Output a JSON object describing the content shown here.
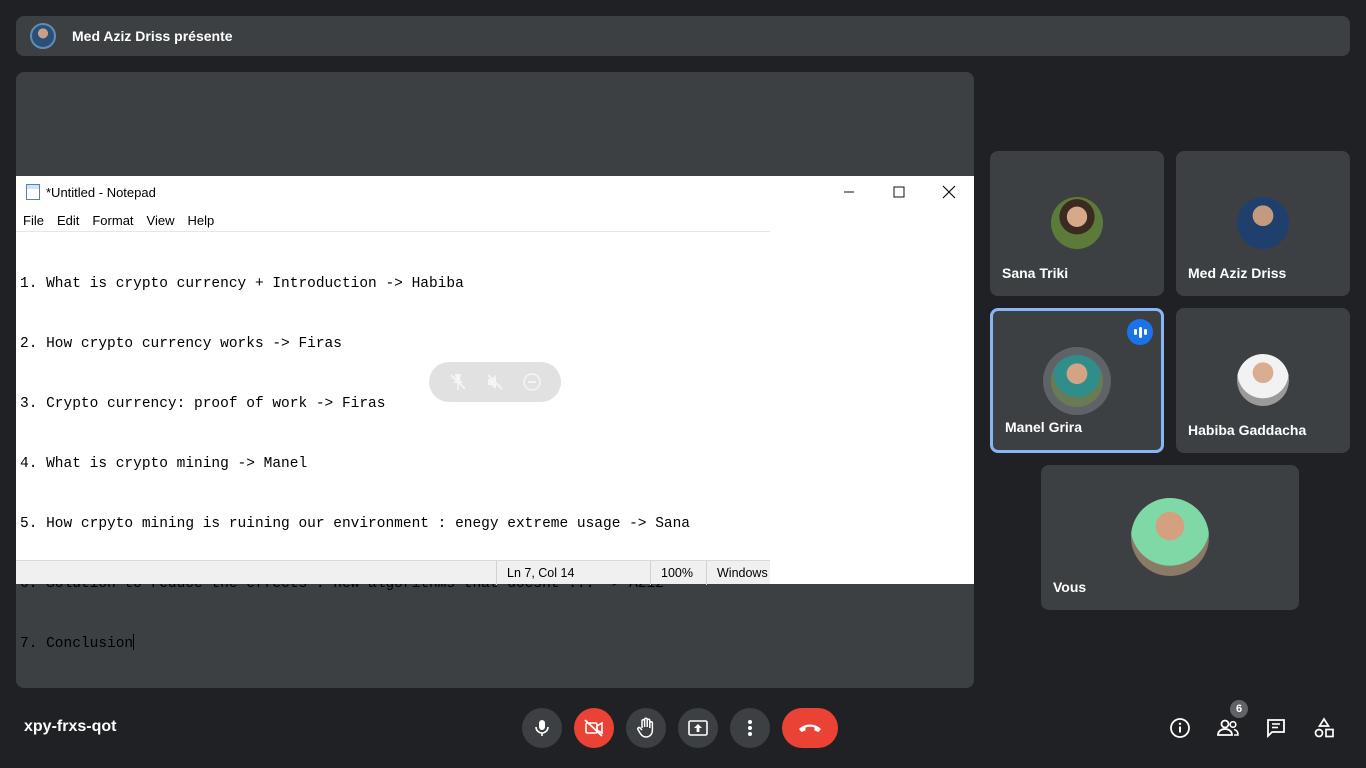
{
  "presenter": {
    "text": "Med Aziz Driss présente"
  },
  "notepad": {
    "title": "*Untitled - Notepad",
    "menu": [
      "File",
      "Edit",
      "Format",
      "View",
      "Help"
    ],
    "lines": [
      "1. What is crypto currency + Introduction -> Habiba",
      "2. How crypto currency works -> Firas",
      "3. Crypto currency: proof of work -> Firas",
      "4. What is crypto mining -> Manel",
      "5. How crpyto mining is ruining our environment : enegy extreme usage -> Sana",
      "6. Solution to reduce the effects : new algorithms that doesnt ... -> Aziz",
      "7. Conclusion"
    ],
    "status": {
      "position": "Ln 7, Col 14",
      "zoom": "100%",
      "line_ending": "Windows"
    }
  },
  "pin_controls": [
    "pin-icon",
    "mute-icon",
    "remove-icon"
  ],
  "participants": [
    {
      "name": "Sana Triki",
      "speaking": false
    },
    {
      "name": "Med Aziz Driss",
      "speaking": false
    },
    {
      "name": "Manel Grira",
      "speaking": true
    },
    {
      "name": "Habiba Gaddacha",
      "speaking": false
    },
    {
      "name": "Vous",
      "speaking": false
    }
  ],
  "meeting": {
    "code": "xpy-frxs-qot",
    "participant_count": "6"
  },
  "controls": [
    "mic-icon",
    "camera-off-icon",
    "raise-hand-icon",
    "present-icon",
    "more-options-icon",
    "hang-up-icon"
  ],
  "side_controls": [
    "info-icon",
    "people-icon",
    "chat-icon",
    "activities-icon"
  ],
  "colors": {
    "background": "#202124",
    "tile": "#3c4043",
    "red": "#ea4335",
    "active_border": "#8ab4f8",
    "speaking_badge": "#1a73e8"
  }
}
